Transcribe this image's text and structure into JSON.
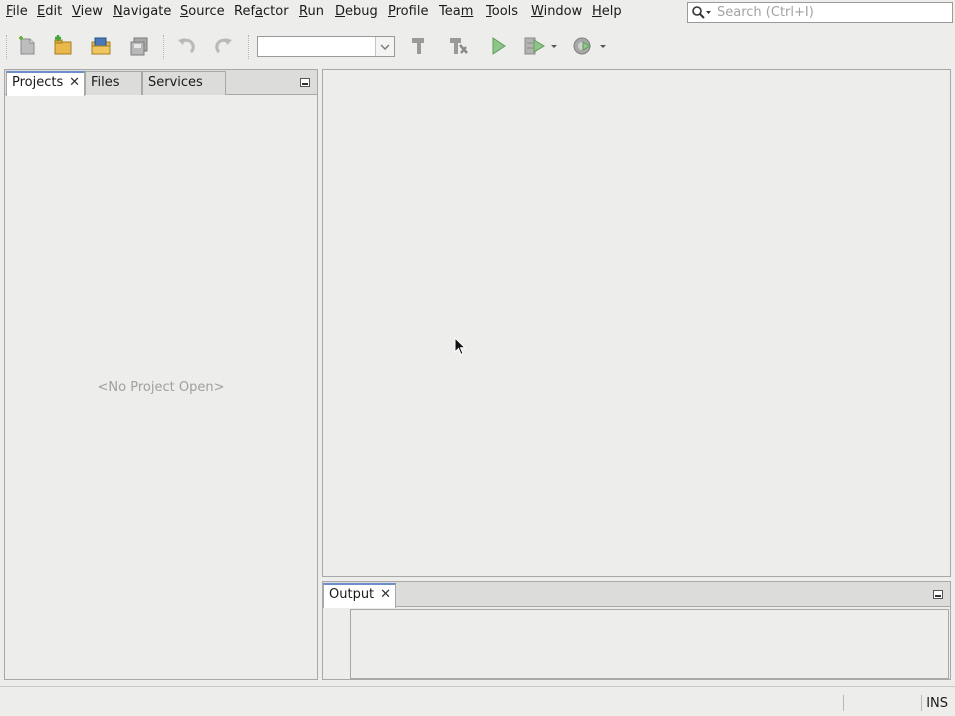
{
  "menubar": {
    "items": [
      {
        "label": "File",
        "mnemonic": 0
      },
      {
        "label": "Edit",
        "mnemonic": 0
      },
      {
        "label": "View",
        "mnemonic": 0
      },
      {
        "label": "Navigate",
        "mnemonic": 0
      },
      {
        "label": "Source",
        "mnemonic": 0
      },
      {
        "label": "Refactor",
        "mnemonic": 3
      },
      {
        "label": "Run",
        "mnemonic": 0
      },
      {
        "label": "Debug",
        "mnemonic": 0
      },
      {
        "label": "Profile",
        "mnemonic": 0
      },
      {
        "label": "Team",
        "mnemonic": 3
      },
      {
        "label": "Tools",
        "mnemonic": 0
      },
      {
        "label": "Window",
        "mnemonic": 0
      },
      {
        "label": "Help",
        "mnemonic": 0
      }
    ],
    "search_placeholder": "Search (Ctrl+I)"
  },
  "toolbar": {
    "buttons": [
      "new-file-icon",
      "new-project-icon",
      "open-project-icon",
      "save-all-icon",
      "undo-icon",
      "redo-icon",
      "build-icon",
      "clean-build-icon",
      "run-icon",
      "debug-icon",
      "profile-icon"
    ],
    "config_value": ""
  },
  "left_panel": {
    "tabs": [
      "Projects",
      "Files",
      "Services"
    ],
    "active_tab": "Projects",
    "close_glyph": "✕",
    "empty_message": "<No Project Open>"
  },
  "output_panel": {
    "tab_label": "Output",
    "close_glyph": "✕"
  },
  "statusbar": {
    "insert_mode": "INS"
  },
  "colors": {
    "background": "#ededeb",
    "active_tab_accent": "#6d8fc9",
    "run_green": "#4caf50"
  }
}
